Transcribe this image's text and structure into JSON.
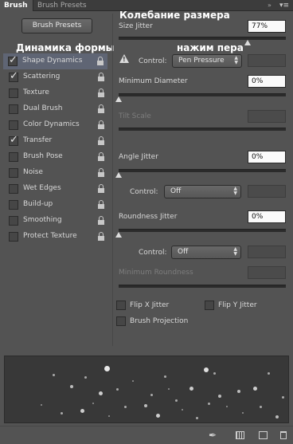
{
  "tabs": {
    "active": "Brush",
    "inactive": "Brush Presets",
    "close_glyph": "»",
    "menu_glyph": "▾≡"
  },
  "brush_presets_button": "Brush Presets",
  "annotations": {
    "size_jitter": "Колебание размера",
    "shape_dynamics": "Динамика формы",
    "pen_pressure": "нажим пера"
  },
  "sidebar": {
    "items": [
      {
        "label": "Shape Dynamics",
        "checked": true,
        "selected": true
      },
      {
        "label": "Scattering",
        "checked": true
      },
      {
        "label": "Texture",
        "checked": false
      },
      {
        "label": "Dual Brush",
        "checked": false
      },
      {
        "label": "Color Dynamics",
        "checked": false
      },
      {
        "label": "Transfer",
        "checked": true
      },
      {
        "label": "Brush Pose",
        "checked": false
      },
      {
        "label": "Noise",
        "checked": false
      },
      {
        "label": "Wet Edges",
        "checked": false
      },
      {
        "label": "Build-up",
        "checked": false
      },
      {
        "label": "Smoothing",
        "checked": false
      },
      {
        "label": "Protect Texture",
        "checked": false
      }
    ]
  },
  "size_jitter": {
    "label": "Size Jitter",
    "value": "77%",
    "level": 0.77,
    "control_label": "Control:",
    "control_value": "Pen Pressure"
  },
  "minimum_diameter": {
    "label": "Minimum Diameter",
    "value": "0%"
  },
  "tilt_scale": {
    "label": "Tilt Scale"
  },
  "angle_jitter": {
    "label": "Angle Jitter",
    "value": "0%",
    "control_label": "Control:",
    "control_value": "Off"
  },
  "roundness_jitter": {
    "label": "Roundness Jitter",
    "value": "0%",
    "control_label": "Control:",
    "control_value": "Off"
  },
  "minimum_roundness": {
    "label": "Minimum Roundness"
  },
  "options": {
    "flip_x": "Flip X Jitter",
    "flip_y": "Flip Y Jitter",
    "brush_projection": "Brush Projection"
  },
  "colors": {
    "panel": "#535353",
    "selected_row": "#5f6574",
    "preview_bg": "#383838"
  },
  "icons": {
    "bottom": [
      "pen-toggle-icon",
      "grid-icon",
      "new-preset-icon"
    ]
  }
}
